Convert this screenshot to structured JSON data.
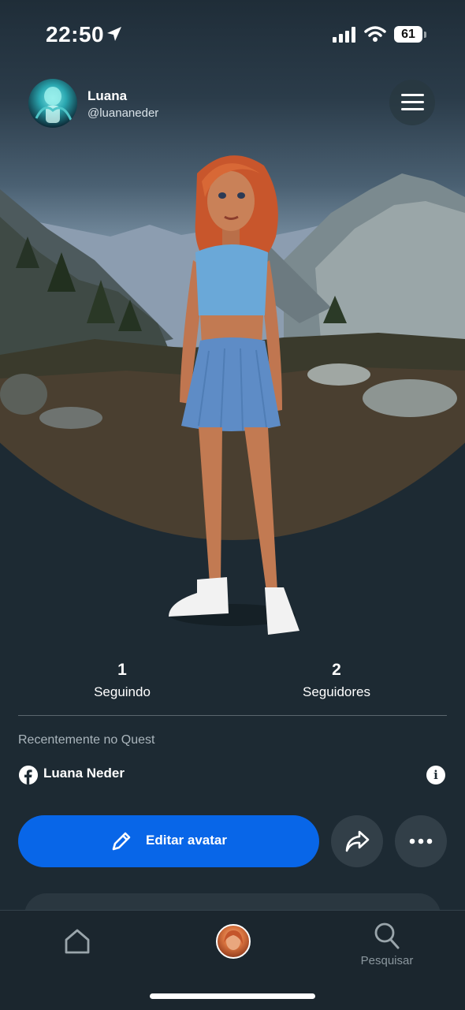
{
  "status_bar": {
    "time": "22:50",
    "battery": "61",
    "icons": [
      "location-arrow-icon",
      "signal-icon",
      "wifi-icon",
      "battery-icon"
    ]
  },
  "profile": {
    "name": "Luana",
    "handle": "@luananeder"
  },
  "stats": [
    {
      "value": "1",
      "label": "Seguindo"
    },
    {
      "value": "2",
      "label": "Seguidores"
    }
  ],
  "recent": {
    "title": "Recentemente no Quest",
    "account_name": "Luana Neder"
  },
  "actions": {
    "edit_avatar_label": "Editar avatar"
  },
  "bottom_nav": {
    "items": [
      {
        "icon": "home-icon",
        "label": ""
      },
      {
        "icon": "avatar-icon",
        "label": ""
      },
      {
        "icon": "search-icon",
        "label": "Pesquisar"
      }
    ]
  },
  "colors": {
    "background": "#1d2a33",
    "primary_button": "#0866e8",
    "secondary_button": "#323f48",
    "muted_text": "#aab5bc"
  }
}
